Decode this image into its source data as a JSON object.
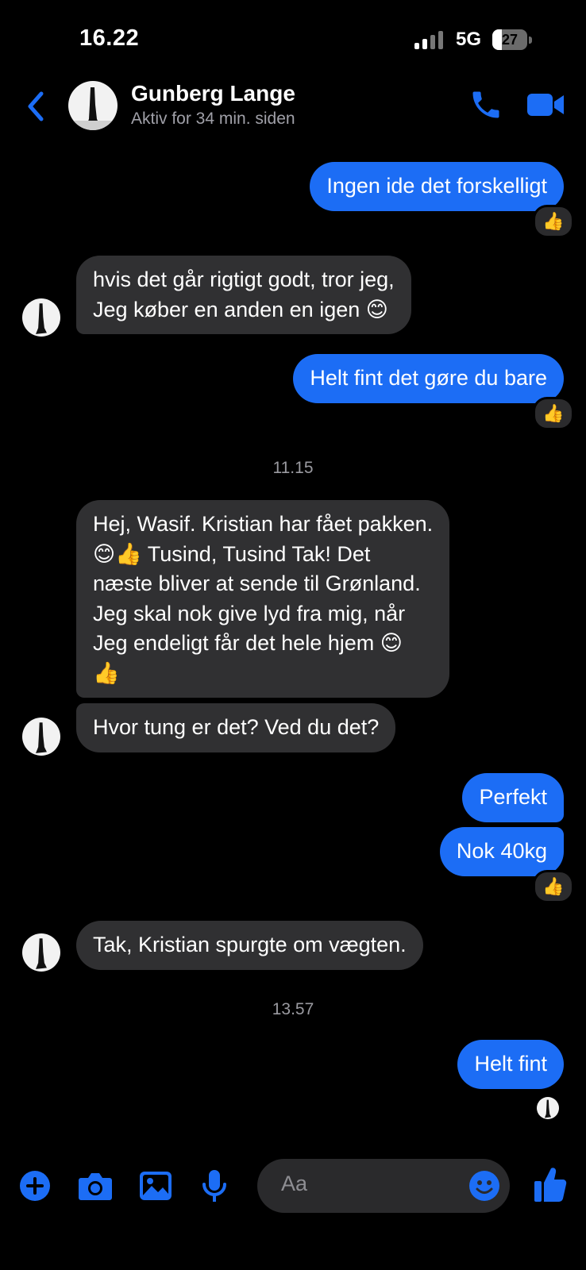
{
  "status_bar": {
    "time": "16.22",
    "network": "5G",
    "battery": "27"
  },
  "header": {
    "name": "Gunberg Lange",
    "status": "Aktiv for 34 min. siden",
    "icons": [
      "chevron-left-icon",
      "phone-icon",
      "video-camera-icon"
    ],
    "accent": "#1c6df5"
  },
  "messages": {
    "m1": {
      "text": "Ingen ide det forskelligt",
      "reaction": "👍"
    },
    "m2": {
      "line1": "hvis det går rigtigt godt, tror jeg,",
      "line2": "Jeg køber en anden en igen 😊"
    },
    "m3": {
      "text": "Helt fint det gøre du bare",
      "reaction": "👍"
    },
    "ts1": "11.15",
    "m4": {
      "line1": "Hej, Wasif. Kristian har fået pakken.",
      "line2": "😊👍 Tusind, Tusind Tak!  Det",
      "line3": "næste bliver at sende til Grønland.",
      "line4": "Jeg skal nok give lyd fra mig, når",
      "line5": "Jeg  endeligt får det hele hjem 😊",
      "line6": "👍"
    },
    "m5": {
      "text": "Hvor tung er det? Ved du det?"
    },
    "m6": {
      "text": "Perfekt"
    },
    "m7": {
      "text": "Nok 40kg",
      "reaction": "👍"
    },
    "m8": {
      "text": "Tak, Kristian spurgte om vægten."
    },
    "ts2": "13.57",
    "m9": {
      "text": "Helt fint"
    }
  },
  "composer": {
    "placeholder": "Aa",
    "icons": [
      "plus-icon",
      "camera-icon",
      "image-icon",
      "microphone-icon",
      "smile-icon",
      "thumbs-up-icon"
    ]
  },
  "colors": {
    "outgoing": "#1c6df5",
    "incoming": "#303032",
    "background": "#000000"
  }
}
